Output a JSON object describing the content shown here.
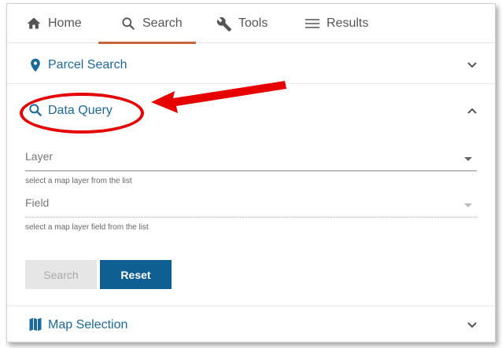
{
  "nav": {
    "tabs": [
      {
        "label": "Home",
        "icon": "home-icon"
      },
      {
        "label": "Search",
        "icon": "search-icon",
        "active": true
      },
      {
        "label": "Tools",
        "icon": "wrench-icon"
      },
      {
        "label": "Results",
        "icon": "list-icon"
      }
    ]
  },
  "sections": {
    "parcel": {
      "label": "Parcel Search",
      "icon": "location-pin-icon",
      "expanded": false
    },
    "query": {
      "label": "Data Query",
      "icon": "search-icon",
      "expanded": true
    },
    "map": {
      "label": "Map Selection",
      "icon": "map-icon",
      "expanded": false
    }
  },
  "query_form": {
    "layer": {
      "label": "Layer",
      "hint": "select a map layer from the list"
    },
    "field": {
      "label": "Field",
      "hint": "select a map layer field from the list"
    },
    "search_button": "Search",
    "reset_button": "Reset"
  },
  "colors": {
    "accent": "#1a6a9c",
    "active_tab": "#c8643a",
    "primary_button": "#0f5f93",
    "annotation": "#e60000"
  }
}
